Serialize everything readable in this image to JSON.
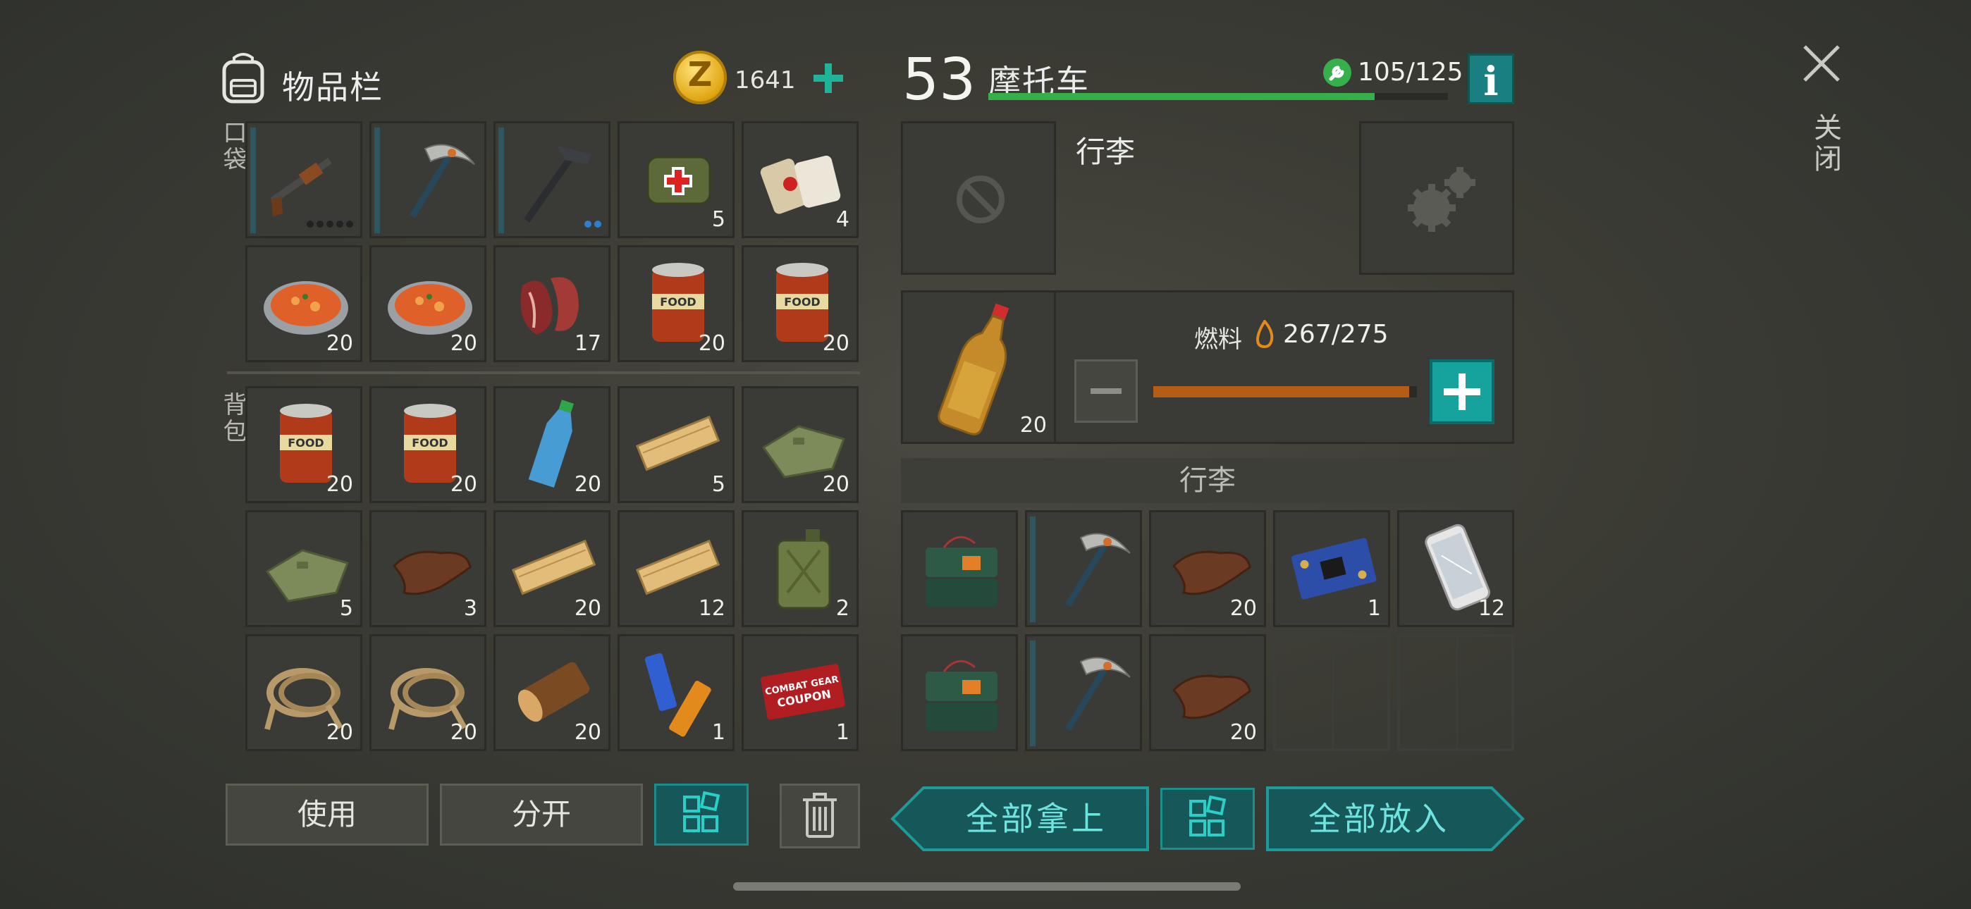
{
  "inventory": {
    "title": "物品栏",
    "coins": "1641",
    "pocket_label": "口袋",
    "backpack_label": "背包",
    "pocket_rows": [
      [
        {
          "item": "shotgun",
          "count": "",
          "durability": true,
          "ammo_dots": 5
        },
        {
          "item": "pickaxe",
          "count": "",
          "durability": true
        },
        {
          "item": "hammer",
          "count": "",
          "durability": true,
          "ammo_dots": 2
        },
        {
          "item": "first-aid-bag",
          "count": "5"
        },
        {
          "item": "bandage",
          "count": "4"
        }
      ],
      [
        {
          "item": "cooked-food-plate",
          "count": "20"
        },
        {
          "item": "cooked-food-plate",
          "count": "20"
        },
        {
          "item": "raw-meat",
          "count": "17"
        },
        {
          "item": "food-can",
          "count": "20"
        },
        {
          "item": "food-can",
          "count": "20"
        }
      ]
    ],
    "backpack_rows": [
      [
        {
          "item": "food-can",
          "count": "20"
        },
        {
          "item": "food-can",
          "count": "20"
        },
        {
          "item": "water-bottle",
          "count": "20"
        },
        {
          "item": "wood-plank",
          "count": "5"
        },
        {
          "item": "cloth",
          "count": "20"
        }
      ],
      [
        {
          "item": "cloth",
          "count": "5"
        },
        {
          "item": "leather",
          "count": "3"
        },
        {
          "item": "wood-plank",
          "count": "20"
        },
        {
          "item": "wood-plank",
          "count": "12"
        },
        {
          "item": "jerrycan",
          "count": "2"
        }
      ],
      [
        {
          "item": "rope",
          "count": "20"
        },
        {
          "item": "rope",
          "count": "20"
        },
        {
          "item": "log",
          "count": "20"
        },
        {
          "item": "batteries",
          "count": "1"
        },
        {
          "item": "coupon",
          "count": "1"
        }
      ]
    ],
    "buttons": {
      "use": "使用",
      "split": "分开"
    }
  },
  "vehicle": {
    "level": "53",
    "name": "摩托车",
    "durability_text": "105/125",
    "durability_fraction": 0.84,
    "luggage_title": "行李",
    "fuel_label": "燃料",
    "fuel_text": "267/275",
    "fuel_fraction": 0.97,
    "fuel_item_count": "20",
    "luggage_header": "行李",
    "luggage_rows": [
      [
        {
          "item": "c4-explosive",
          "count": ""
        },
        {
          "item": "pickaxe",
          "count": "",
          "durability": true
        },
        {
          "item": "leather",
          "count": "20"
        },
        {
          "item": "circuit-board",
          "count": "1"
        },
        {
          "item": "smartphone",
          "count": "12"
        }
      ],
      [
        {
          "item": "c4-explosive",
          "count": ""
        },
        {
          "item": "pickaxe",
          "count": "",
          "durability": true
        },
        {
          "item": "leather",
          "count": "20"
        },
        {
          "item": "empty",
          "count": ""
        },
        {
          "item": "empty",
          "count": ""
        }
      ]
    ],
    "buttons": {
      "take_all": "全部拿上",
      "put_all": "全部放入"
    }
  },
  "close_label": "关闭",
  "colors": {
    "accent_teal": "#1a7f80",
    "hp_green": "#35b04a",
    "fuel_orange": "#b35e14",
    "coin_gold": "#e0a612"
  }
}
